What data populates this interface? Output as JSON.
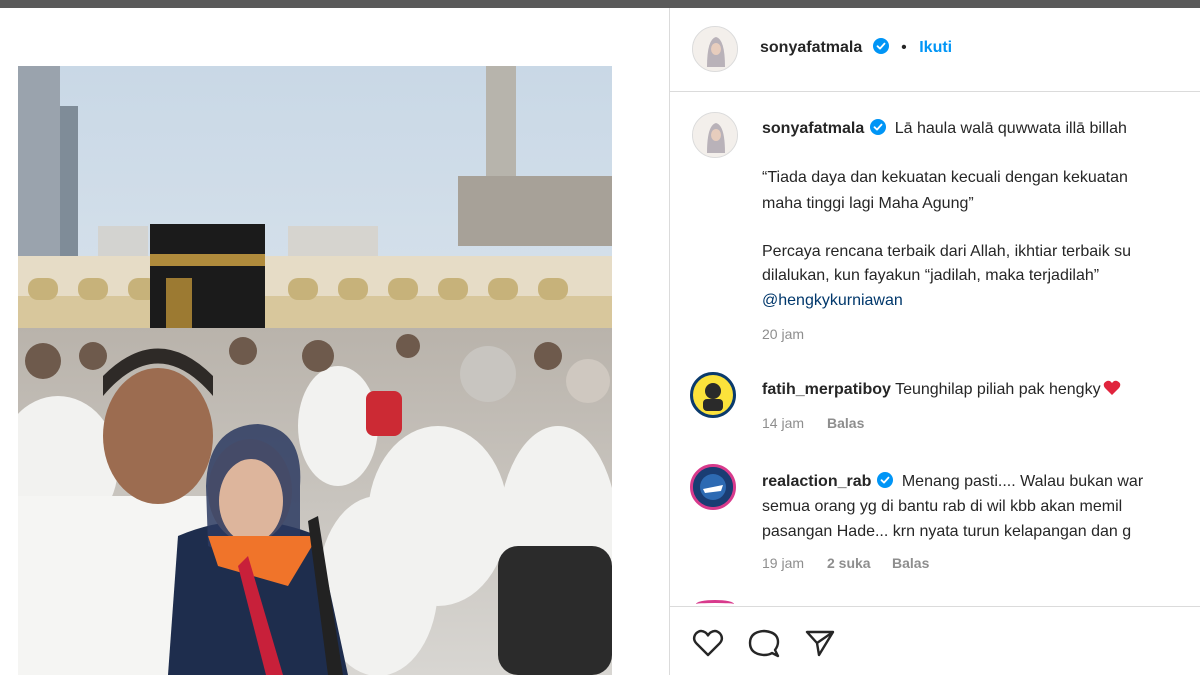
{
  "post": {
    "author": "sonyafatmala",
    "follow_label": "Ikuti",
    "dot": "•"
  },
  "caption": {
    "username": "sonyafatmala",
    "lines": [
      "Lā haula walā quwwata illā billah",
      "“Tiada daya dan kekuatan kecuali dengan kekuatan",
      "maha tinggi lagi Maha Agung”",
      "Percaya rencana terbaik dari Allah, ikhtiar terbaik su",
      "dilalukan, kun fayakun “jadilah, maka terjadilah”"
    ],
    "mention": "@hengkykurniawan",
    "time": "20 jam"
  },
  "comments": [
    {
      "username": "fatih_merpatiboy",
      "text": "Teunghilap piliah pak hengky",
      "time": "14 jam",
      "reply": "Balas"
    },
    {
      "username": "realaction_rab",
      "lines": [
        "Menang pasti.... Walau bukan war",
        "semua orang yg di bantu rab di wil kbb akan memil",
        "pasangan Hade... krn nyata turun kelapangan dan g"
      ],
      "time": "19 jam",
      "likes": "2 suka",
      "reply": "Balas"
    }
  ],
  "colors": {
    "accent": "#0095f6",
    "verified": "#0095f6",
    "heart": "#e0243d",
    "muted": "#8e8e8e"
  },
  "icons": {
    "like": "heart-outline-icon",
    "comment": "speech-bubble-icon",
    "share": "paper-plane-icon",
    "verified": "verified-badge-icon"
  }
}
